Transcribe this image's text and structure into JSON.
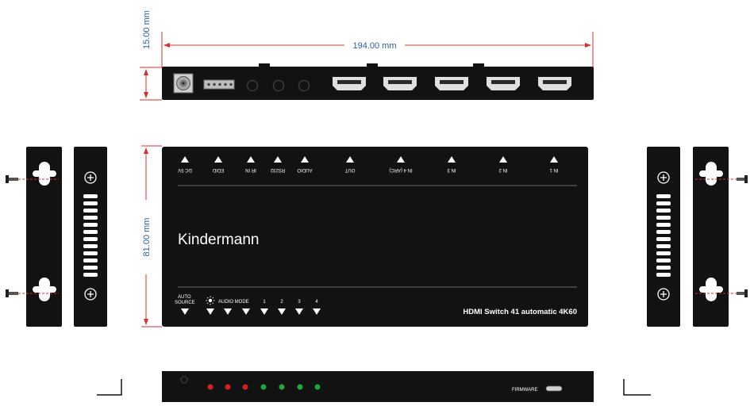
{
  "dimensions": {
    "height_side": "15.00 mm",
    "length": "194.00 mm",
    "width_top": "81.00 mm"
  },
  "top_view": {
    "brand": "Kindermann",
    "product": "HDMI Switch 41 automatic 4K60",
    "port_labels": [
      "DC 5V",
      "EDID",
      "IR IN",
      "RS232",
      "AUDIO",
      "OUT",
      "IN 4 (ARC)",
      "IN 3",
      "IN 2",
      "IN 1"
    ],
    "control_labels": {
      "auto": "AUTO",
      "source": "SOURCE",
      "audio_mode": "AUDIO MODE",
      "inputs": [
        "1",
        "2",
        "3",
        "4"
      ]
    }
  },
  "front_view": {
    "firmware_label": "FIRMWARE",
    "led_colors": [
      "#d42020",
      "#d42020",
      "#d42020",
      "#22a83a",
      "#22a83a",
      "#22a83a",
      "#22a83a"
    ]
  },
  "colors": {
    "dimension": "#2a5f9e",
    "arrow_red": "#d63030",
    "body": "#121212"
  }
}
